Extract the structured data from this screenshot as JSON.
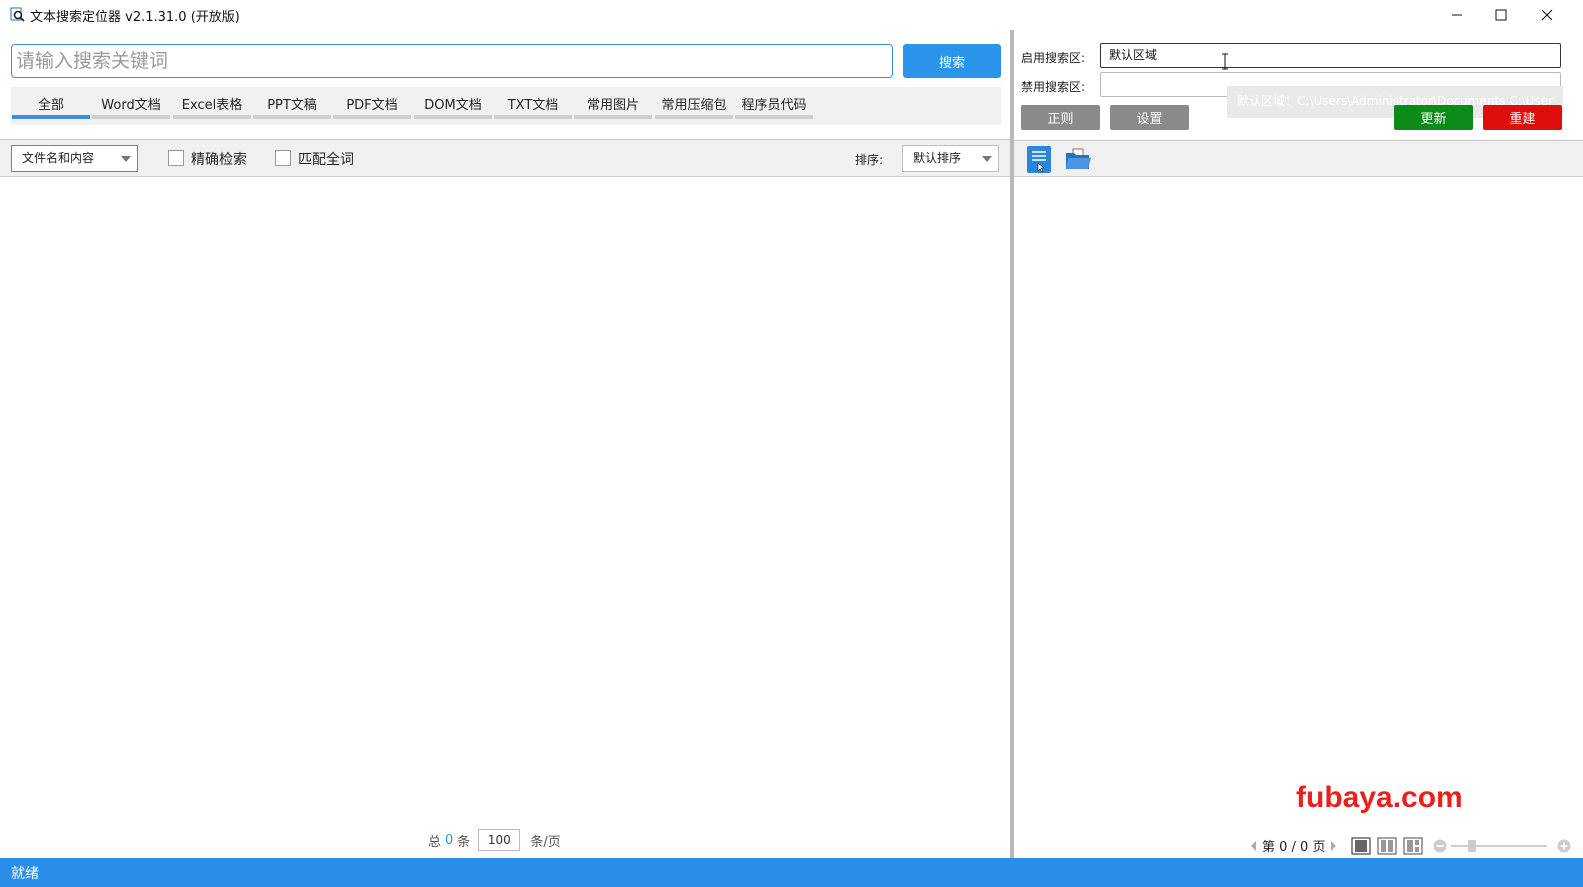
{
  "window": {
    "title": "文本搜索定位器 v2.1.31.0 (开放版)",
    "controls": [
      "minimize-icon",
      "maximize-icon",
      "close-icon"
    ]
  },
  "search": {
    "placeholder": "请输入搜索关键词",
    "value": "",
    "button_label": "搜索"
  },
  "tabs": [
    {
      "label": "全部",
      "active": true
    },
    {
      "label": "Word文档",
      "active": false
    },
    {
      "label": "Excel表格",
      "active": false
    },
    {
      "label": "PPT文稿",
      "active": false
    },
    {
      "label": "PDF文档",
      "active": false
    },
    {
      "label": "DOM文档",
      "active": false
    },
    {
      "label": "TXT文档",
      "active": false
    },
    {
      "label": "常用图片",
      "active": false
    },
    {
      "label": "常用压缩包",
      "active": false
    },
    {
      "label": "程序员代码",
      "active": false
    }
  ],
  "filters": {
    "scope_selected": "文件名和内容",
    "exact_search_label": "精确检索",
    "exact_search_checked": false,
    "whole_word_label": "匹配全词",
    "whole_word_checked": false,
    "sort_label": "排序:",
    "sort_selected": "默认排序"
  },
  "pager": {
    "total_prefix": "总",
    "total_count": "0",
    "total_suffix": "条",
    "page_size": "100",
    "page_size_unit": "条/页"
  },
  "areas": {
    "enable_label": "启用搜索区:",
    "enable_value": "默认区域",
    "disable_label": "禁用搜索区:",
    "disable_value": "",
    "tooltip": "默认区域：C:\\Users\\Administrator\\Documents C:\\User"
  },
  "buttons": {
    "regex": "正则",
    "settings": "设置",
    "update": "更新",
    "rebuild": "重建"
  },
  "colors": {
    "accent": "#2a95eb",
    "update": "#0c8a1a",
    "rebuild": "#e00d0d",
    "gray_button": "#8a8a8a",
    "watermark": "#e8211c"
  },
  "viewer": {
    "toolbar_icons": [
      "document-list-icon",
      "open-folder-icon"
    ],
    "page_text": "第 0 / 0 页",
    "view_icons": [
      "single-page-icon",
      "two-page-icon",
      "thumbnail-page-icon"
    ],
    "zoom_icons": [
      "zoom-out-icon",
      "zoom-in-icon"
    ]
  },
  "watermark": "fubaya.com",
  "status": "就绪"
}
